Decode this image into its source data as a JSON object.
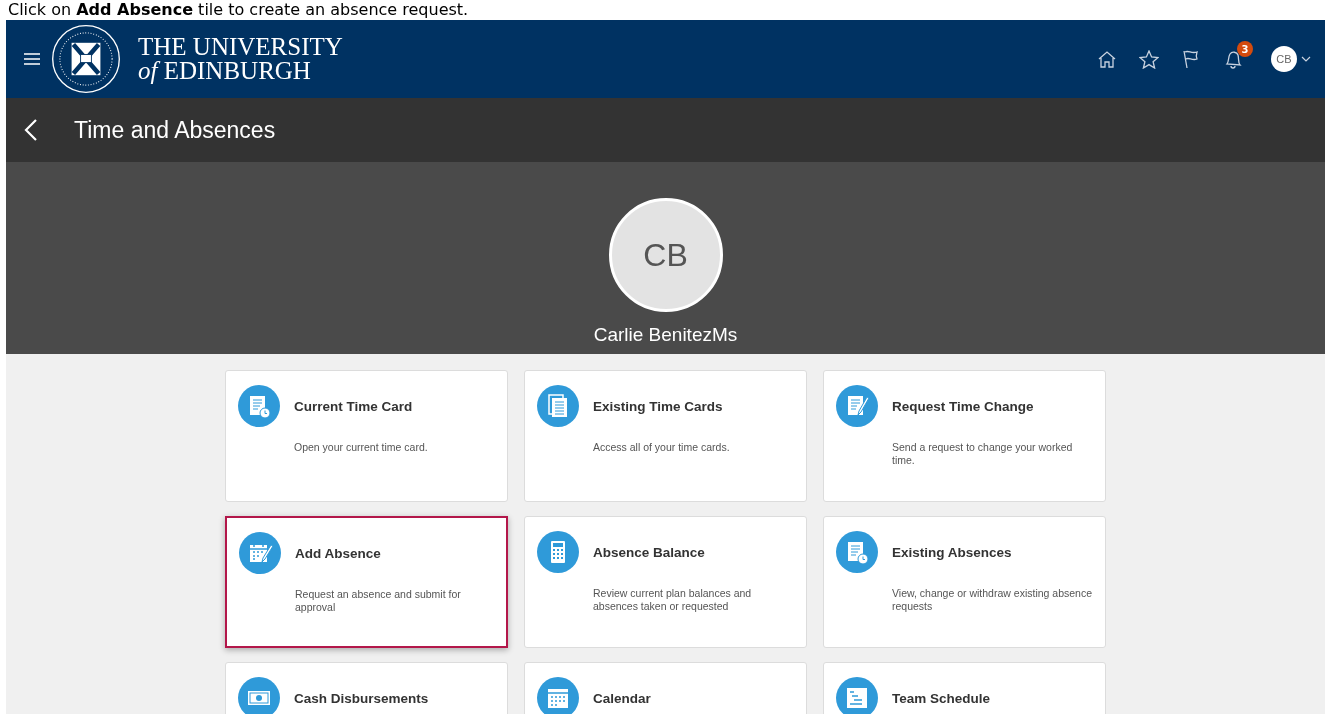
{
  "caption": "Click on **Add Absence** tile to create an absence request.",
  "header": {
    "logo_line_1": "THE UNIVERSITY",
    "logo_line_2": "*of* EDINBURGH",
    "notification_count": "3",
    "avatar_initials": "CB"
  },
  "page_title": "Time and Absences",
  "profile": {
    "initials": "CB",
    "name": "Carlie BenitezMs"
  },
  "tiles": [
    {
      "kind": "timecard",
      "title": "Current Time Card",
      "description": "Open your current time card.",
      "highlighted": false
    },
    {
      "kind": "cards",
      "title": "Existing Time Cards",
      "description": "Access all of your time cards.",
      "highlighted": false
    },
    {
      "kind": "edit",
      "title": "Request Time Change",
      "description": "Send a request to change your worked time.",
      "highlighted": false
    },
    {
      "kind": "calendar-edit",
      "title": "Add Absence",
      "description": "Request an absence and submit for approval",
      "highlighted": true
    },
    {
      "kind": "calculator",
      "title": "Absence Balance",
      "description": "Review current plan balances and absences taken or requested",
      "highlighted": false
    },
    {
      "kind": "timecard",
      "title": "Existing Absences",
      "description": "View, change or withdraw existing absence requests",
      "highlighted": false
    },
    {
      "kind": "cash",
      "title": "Cash Disbursements",
      "highlighted": false
    },
    {
      "kind": "calendar",
      "title": "Calendar",
      "highlighted": false
    },
    {
      "kind": "schedule",
      "title": "Team Schedule",
      "highlighted": false
    }
  ]
}
